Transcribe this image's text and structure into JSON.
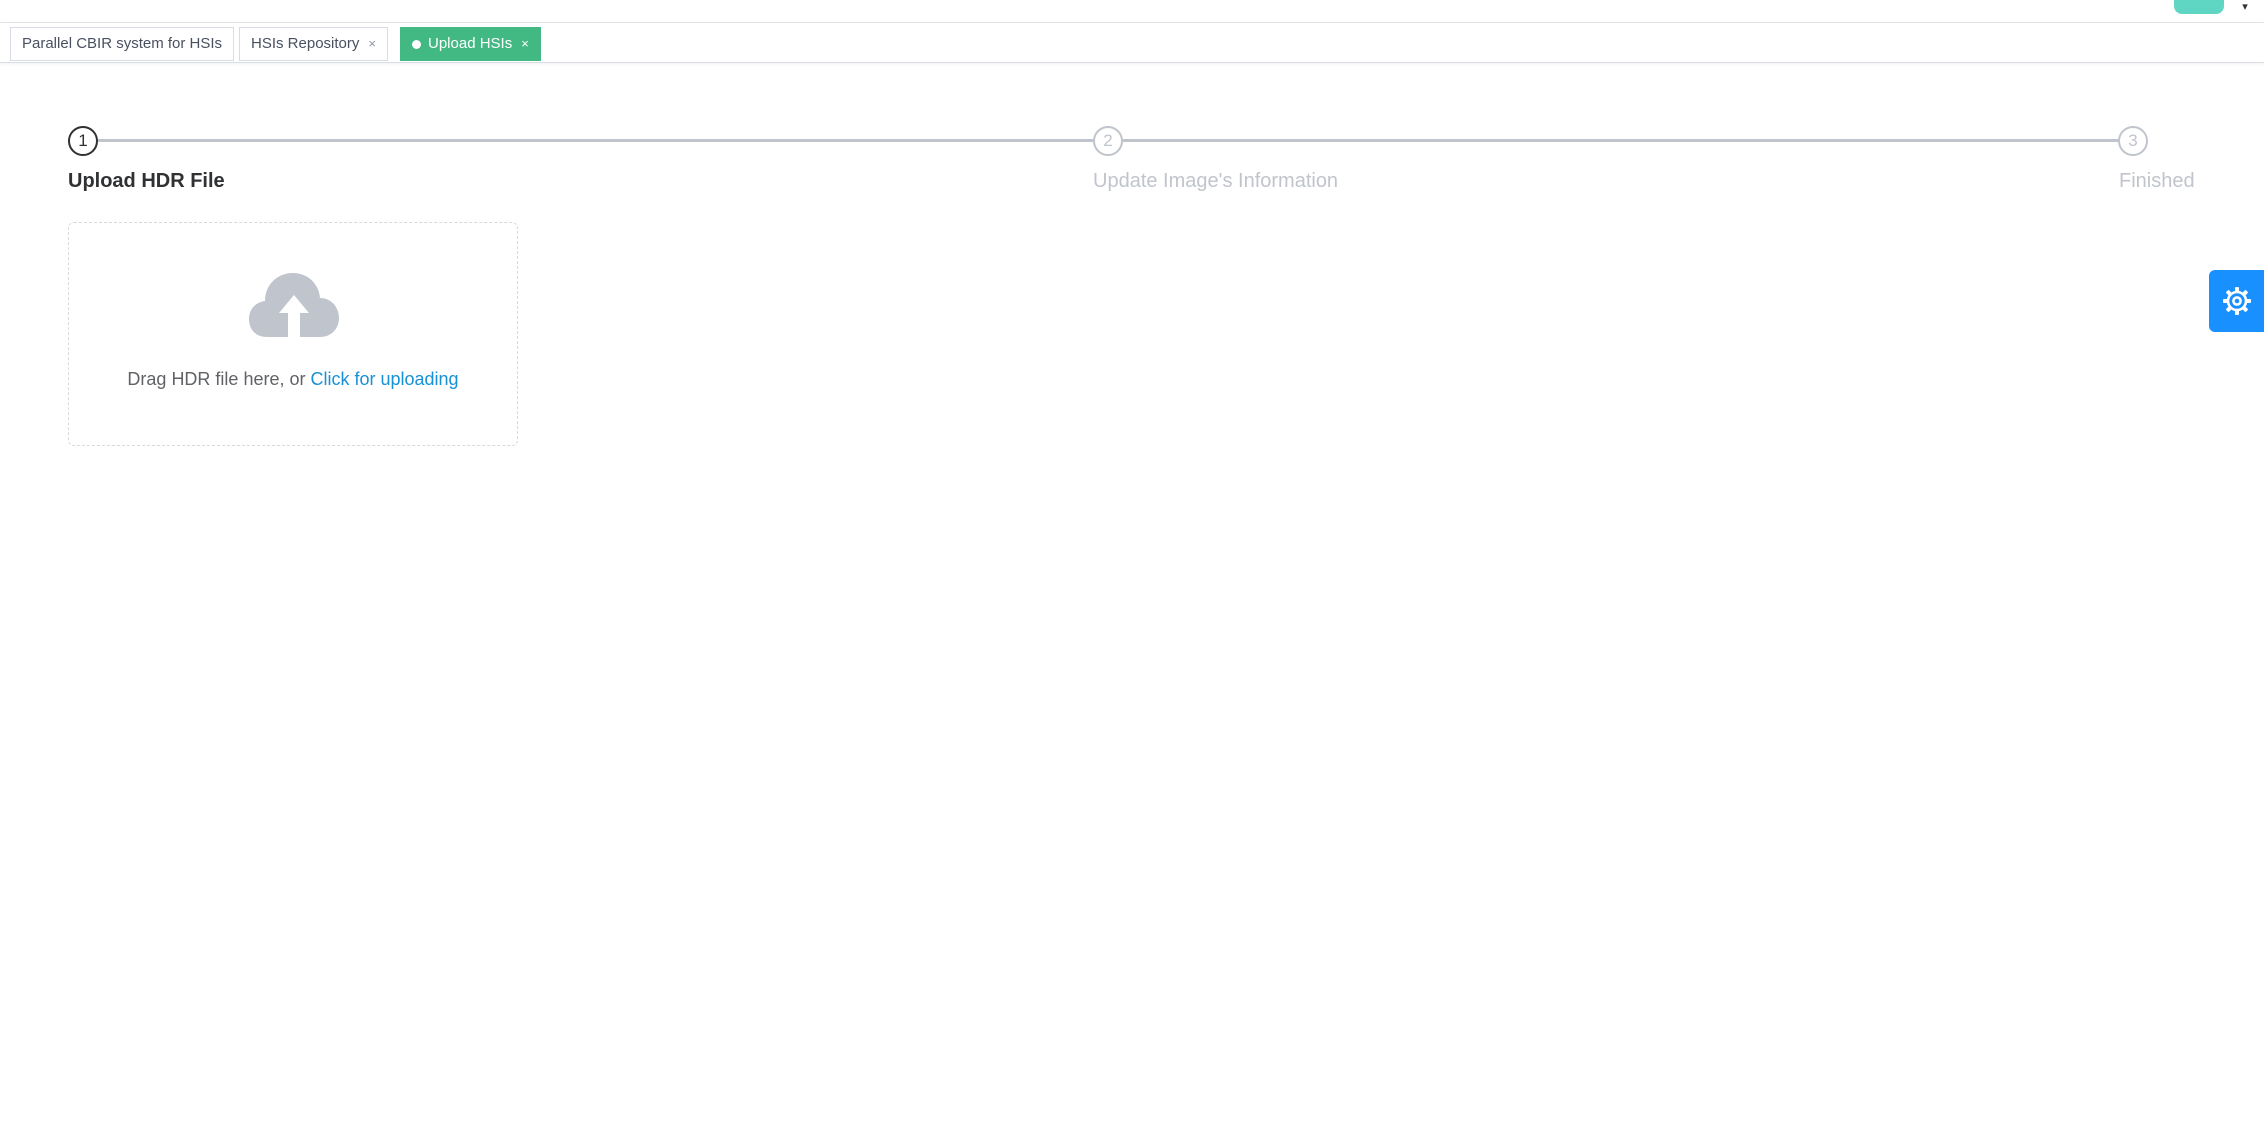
{
  "tags": [
    {
      "label": "Parallel CBIR system for HSIs",
      "closable": false,
      "active": false
    },
    {
      "label": "HSIs Repository",
      "closable": true,
      "active": false
    },
    {
      "label": "Upload HSIs",
      "closable": true,
      "active": true
    }
  ],
  "tag_close_glyph": "×",
  "steps": [
    {
      "number": "1",
      "title": "Upload HDR File",
      "status": "active"
    },
    {
      "number": "2",
      "title": "Update Image's Information",
      "status": "wait"
    },
    {
      "number": "3",
      "title": "Finished",
      "status": "wait"
    }
  ],
  "upload": {
    "hint_prefix": "Drag HDR file here, or ",
    "link_text": "Click for uploading",
    "icon": "cloud-upload-icon"
  },
  "settings": {
    "icon": "gear-icon"
  },
  "navbar": {
    "avatar_icon": "avatar",
    "caret_glyph": "▾"
  },
  "colors": {
    "tag_active": "#42b983",
    "link": "#1890d6",
    "settings_button": "#1890ff",
    "step_active": "#303133",
    "step_wait": "#c0c4cc"
  }
}
